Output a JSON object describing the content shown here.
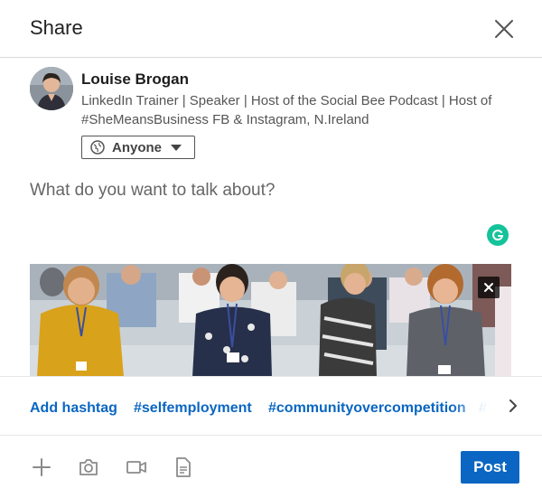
{
  "modal": {
    "title": "Share",
    "close_icon": "close-icon"
  },
  "author": {
    "name": "Louise Brogan",
    "headline": "LinkedIn Trainer | Speaker | Host of the Social Bee Podcast | Host of #SheMeansBusiness FB & Instagram, N.Ireland"
  },
  "audience": {
    "label": "Anyone",
    "icon": "globe-icon"
  },
  "composer": {
    "placeholder": "What do you want to talk about?"
  },
  "hashtags": {
    "add_label": "Add hashtag",
    "suggestions": [
      "#selfemployment",
      "#communityovercompetition",
      "#f"
    ]
  },
  "toolbar": {
    "icons": [
      "plus-icon",
      "camera-icon",
      "video-icon",
      "document-icon"
    ],
    "post_label": "Post"
  },
  "colors": {
    "brand_blue": "#0a66c2",
    "grammarly_green": "#15c39a"
  }
}
